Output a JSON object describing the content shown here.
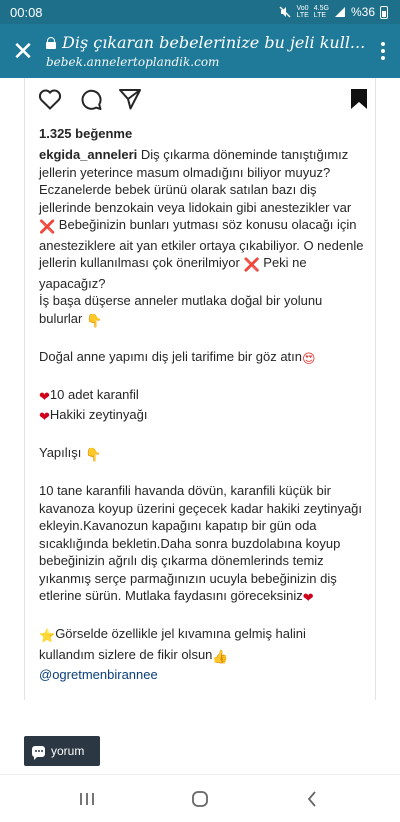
{
  "status_bar": {
    "time": "00:08",
    "volte_top": "Vo0",
    "volte_bottom": "LTE",
    "net_top": "4.5G",
    "net_bottom": "LTE",
    "battery": "%36"
  },
  "app_bar": {
    "title": "Diş çıkaran bebelerinize bu jeli kull...",
    "url": "bebek.annelertoplandik.com"
  },
  "post": {
    "likes": "1.325 beğenme",
    "username": "ekgida_anneleri",
    "caption_1": "Diş çıkarma döneminde tanıştığımız jellerin yeterince masum olmadığını biliyor muyuz? Eczanelerde bebek ürünü olarak satılan bazı diş jellerinde benzokain veya lidokain gibi anestezikler var",
    "cross_1": "❌",
    "caption_2": " Bebeğinizin bunları yutması söz konusu olacağı için anesteziklere ait yan etkiler ortaya çıkabiliyor. O nedenle jellerin kullanılması çok önerilmiyor ",
    "cross_2": "❌",
    "caption_3": " Peki ne yapacağız?",
    "line_4": "İş başa düşerse anneler mutlaka doğal bir yolunu bulurlar",
    "hand_1": "👇",
    "line_5": "Doğal anne yapımı diş jeli tarifime bir göz atın",
    "blush_emoji": "😍",
    "heart_1": "❤",
    "ingredient_1": "10 adet karanfil",
    "heart_2": "❤",
    "ingredient_2": "Hakiki zeytinyağı",
    "recipe_title": "Yapılışı",
    "hand_2": "👇",
    "recipe_text": "10 tane karanfili havanda dövün, karanfili küçük bir kavanoza koyup üzerini geçecek kadar hakiki zeytinyağı ekleyin.Kavanozun kapağını kapatıp bir gün oda sıcaklığında bekletin.Daha sonra buzdolabına koyup bebeğinizin ağrılı diş çıkarma dönemlerinds temiz yıkanmış serçe parmağınızın ucuyla bebeğinizin diş etlerine sürün. Mutlaka faydasını göreceksiniz",
    "heart_3": "❤",
    "star_emoji": "⭐",
    "final_text": "Görselde özellikle jel kıvamına gelmiş halini kullandım sizlere de fikir olsun",
    "hand_3": "👍",
    "mention": "@ogretmenbirannee"
  },
  "comment_button": {
    "label": "yorum"
  },
  "icons": {
    "close": "close-icon",
    "lock": "lock-icon",
    "menu": "more-vert-icon",
    "like": "heart-outline-icon",
    "comment": "comment-bubble-icon",
    "share": "send-icon",
    "save": "bookmark-icon"
  },
  "colors": {
    "app_bar": "#1e7a98",
    "status_bar": "#1e6f8a",
    "comment_button": "#2b3743",
    "mention": "#0a3f7a"
  }
}
